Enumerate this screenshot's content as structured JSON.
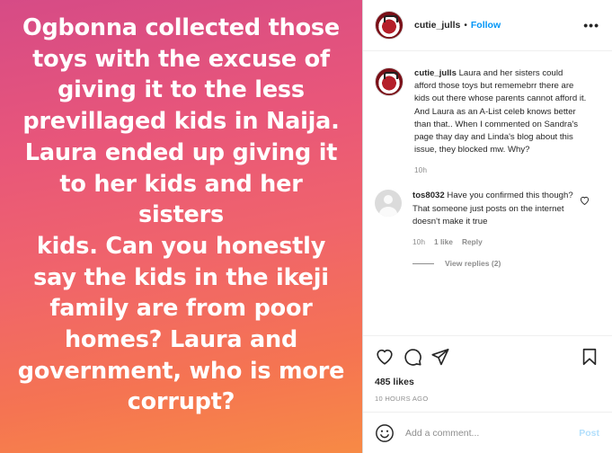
{
  "media": {
    "text_lines": [
      "Ogbonna collected those",
      "toys with the excuse of",
      "giving it to the less",
      "previllaged kids in Naija.",
      "Laura ended up giving it",
      "to her kids and her sisters",
      "kids. Can you honestly",
      "say the kids in the ikeji",
      "family are from poor",
      "homes? Laura and",
      "government, who is more",
      "corrupt?"
    ]
  },
  "header": {
    "username": "cutie_julls",
    "separator": "•",
    "follow_label": "Follow",
    "more_label": "•••"
  },
  "caption": {
    "username": "cutie_julls",
    "text": "Laura and her sisters could afford those toys but rememebrr there are kids out there whose parents cannot afford it. And Laura as an A-List celeb knows better than that.. When I commented on Sandra's page thay day and Linda's blog about this issue, they blocked mw. Why?",
    "time": "10h"
  },
  "comment": {
    "username": "tos8032",
    "text": "Have you confirmed this though? That someone just posts on the internet doesn't make it true",
    "time": "10h",
    "likes": "1 like",
    "reply_label": "Reply",
    "view_replies": "View replies (2)"
  },
  "actions": {
    "likes": "485 likes",
    "timestamp": "10 HOURS AGO"
  },
  "add_comment": {
    "placeholder": "Add a comment...",
    "post_label": "Post"
  },
  "icons": {
    "like": "heart-icon",
    "comment": "comment-icon",
    "share": "paper-plane-icon",
    "save": "bookmark-icon",
    "emoji": "smiley-icon",
    "comment_like": "small-heart-icon"
  },
  "colors": {
    "follow": "#0095f6",
    "post_disabled": "#b2dffc",
    "gradient_top": "#d64b86",
    "gradient_bottom": "#f78a45"
  }
}
